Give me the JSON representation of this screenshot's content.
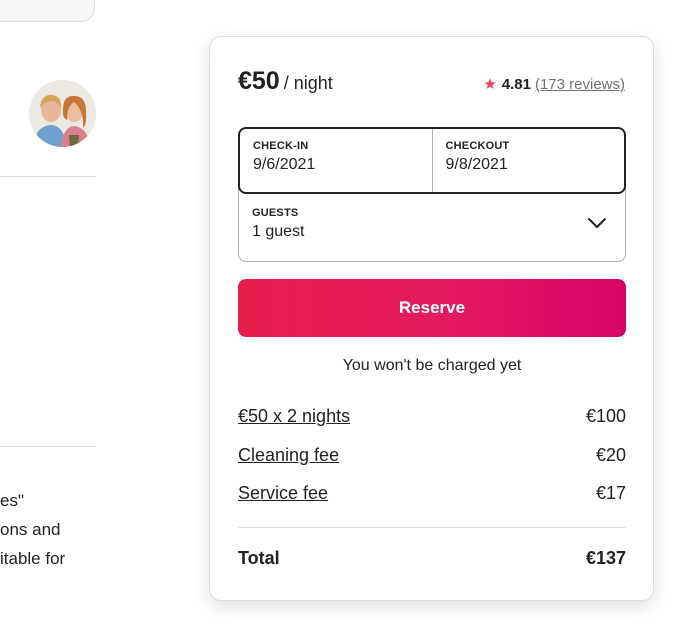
{
  "listing": {
    "host_avatar_alt": "Host photo",
    "description_fragments": [
      "es\"",
      "ons and",
      "itable for"
    ]
  },
  "booking": {
    "price": "€50",
    "per_night": "/ night",
    "rating": {
      "star_icon": "star-icon",
      "value": "4.81",
      "reviews": "(173 reviews)"
    },
    "check_in": {
      "label": "CHECK-IN",
      "value": "9/6/2021"
    },
    "checkout": {
      "label": "CHECKOUT",
      "value": "9/8/2021"
    },
    "guests": {
      "label": "GUESTS",
      "value": "1 guest",
      "icon": "chevron-down-icon"
    },
    "reserve_label": "Reserve",
    "not_charged": "You won't be charged yet",
    "line_items": [
      {
        "label": "€50 x 2 nights",
        "amount": "€100"
      },
      {
        "label": "Cleaning fee",
        "amount": "€20"
      },
      {
        "label": "Service fee",
        "amount": "€17"
      }
    ],
    "total": {
      "label": "Total",
      "amount": "€137"
    }
  },
  "colors": {
    "brand": "#ff385c",
    "reserve_gradient_start": "#e61e4d",
    "reserve_gradient_end": "#d70466",
    "text": "#222222",
    "muted": "#717171"
  }
}
